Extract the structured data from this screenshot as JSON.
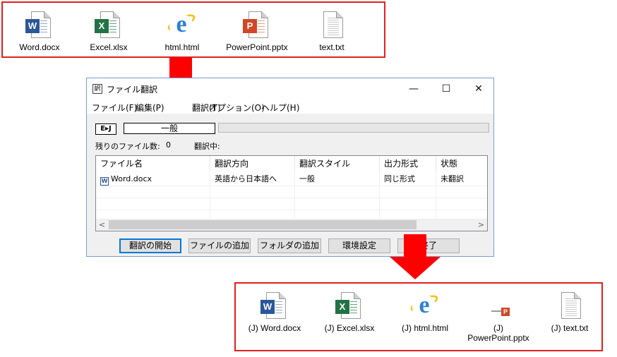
{
  "source_files": [
    {
      "label": "Word.docx",
      "icon": "word-icon"
    },
    {
      "label": "Excel.xlsx",
      "icon": "excel-icon"
    },
    {
      "label": "html.html",
      "icon": "html-icon"
    },
    {
      "label": "PowerPoint.pptx",
      "icon": "powerpoint-icon"
    },
    {
      "label": "text.txt",
      "icon": "text-icon"
    }
  ],
  "translated_files": [
    {
      "label": "(J) Word.docx",
      "icon": "word-icon"
    },
    {
      "label": "(J) Excel.xlsx",
      "icon": "excel-icon"
    },
    {
      "label": "(J) html.html",
      "icon": "html-icon"
    },
    {
      "label_line1": "(J)",
      "label_line2": "PowerPoint.pptx",
      "icon": "powerpoint-icon"
    },
    {
      "label": "(J) text.txt",
      "icon": "text-icon"
    }
  ],
  "window": {
    "title": "ファイル翻訳",
    "controls": {
      "minimize": "—",
      "maximize": "☐",
      "close": "✕"
    },
    "menu": [
      "ファイル(F)",
      "編集(P)",
      "翻訳(T)",
      "オプション(O)",
      "ヘルプ(H)"
    ],
    "direction_badge": "E▸J",
    "style_value": "一般",
    "remaining_label": "残りのファイル数:",
    "remaining_count": "0",
    "translating_label": "翻訳中:",
    "columns": [
      "ファイル名",
      "翻訳方向",
      "翻訳スタイル",
      "出力形式",
      "状態"
    ],
    "rows": [
      {
        "file": "Word.docx",
        "direction": "英語から日本語へ",
        "style": "一般",
        "format": "同じ形式",
        "status": "未翻訳"
      }
    ],
    "buttons": {
      "start": "翻訳の開始",
      "add_file": "ファイルの追加",
      "add_folder": "フォルダの追加",
      "settings": "環境設定",
      "close": "終了"
    }
  },
  "colors": {
    "accent": "#e02020",
    "arrow": "#ff0000",
    "word": "#2b579a",
    "excel": "#217346",
    "powerpoint": "#d24726"
  }
}
